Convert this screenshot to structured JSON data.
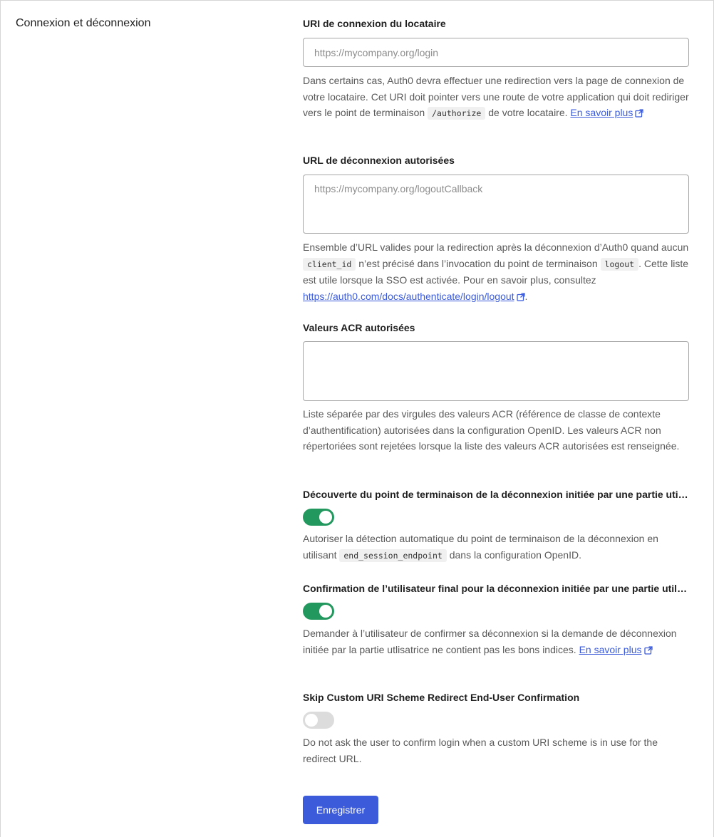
{
  "section": {
    "title": "Connexion et déconnexion"
  },
  "login_uri": {
    "label": "URI de connexion du locataire",
    "placeholder": "https://mycompany.org/login",
    "value": "",
    "help_part1": "Dans certains cas, Auth0 devra effectuer une redirection vers la page de connexion de votre locataire. Cet URI doit pointer vers une route de votre application qui doit rediriger vers le point de terminaison ",
    "help_code": "/authorize",
    "help_part2": " de votre locataire. ",
    "help_link": "En savoir plus"
  },
  "logout_urls": {
    "label": "URL de déconnexion autorisées",
    "placeholder": "https://mycompany.org/logoutCallback",
    "value": "",
    "help_part1": "Ensemble d’URL valides pour la redirection après la déconnexion d’Auth0 quand aucun ",
    "help_code1": "client_id",
    "help_part2": " n’est précisé dans l’invocation du point de terminaison ",
    "help_code2": "logout",
    "help_part3": ". Cette liste est utile lorsque la SSO est activée. Pour en savoir plus, consultez ",
    "help_link": "https://auth0.com/docs/authenticate/login/logout",
    "help_part4": "."
  },
  "acr_values": {
    "label": "Valeurs ACR autorisées",
    "value": "",
    "help": "Liste séparée par des virgules des valeurs ACR (référence de classe de contexte d’authentification) autorisées dans la configuration OpenID. Les valeurs ACR non répertoriées sont rejetées lorsque la liste des valeurs ACR autorisées est renseignée."
  },
  "rp_logout_discovery": {
    "label": "Découverte du point de terminaison de la déconnexion initiée par une partie utilisatrice",
    "enabled": true,
    "help_part1": "Autoriser la détection automatique du point de terminaison de la déconnexion en utilisant ",
    "help_code": "end_session_endpoint",
    "help_part2": " dans la configuration OpenID."
  },
  "rp_logout_confirmation": {
    "label": "Confirmation de l’utilisateur final pour la déconnexion initiée par une partie utilisatrice",
    "enabled": true,
    "help": "Demander à l’utilisateur de confirmer sa déconnexion si la demande de déconnexion initiée par la partie utlisatrice ne contient pas les bons indices. ",
    "help_link": "En savoir plus"
  },
  "skip_custom_uri": {
    "label": "Skip Custom URI Scheme Redirect End-User Confirmation",
    "enabled": false,
    "help": "Do not ask the user to confirm login when a custom URI scheme is in use for the redirect URL."
  },
  "actions": {
    "save_label": "Enregistrer"
  },
  "colors": {
    "accent": "#3b5bdb",
    "toggle_on": "#23985e",
    "toggle_off": "#dcdcdc"
  }
}
